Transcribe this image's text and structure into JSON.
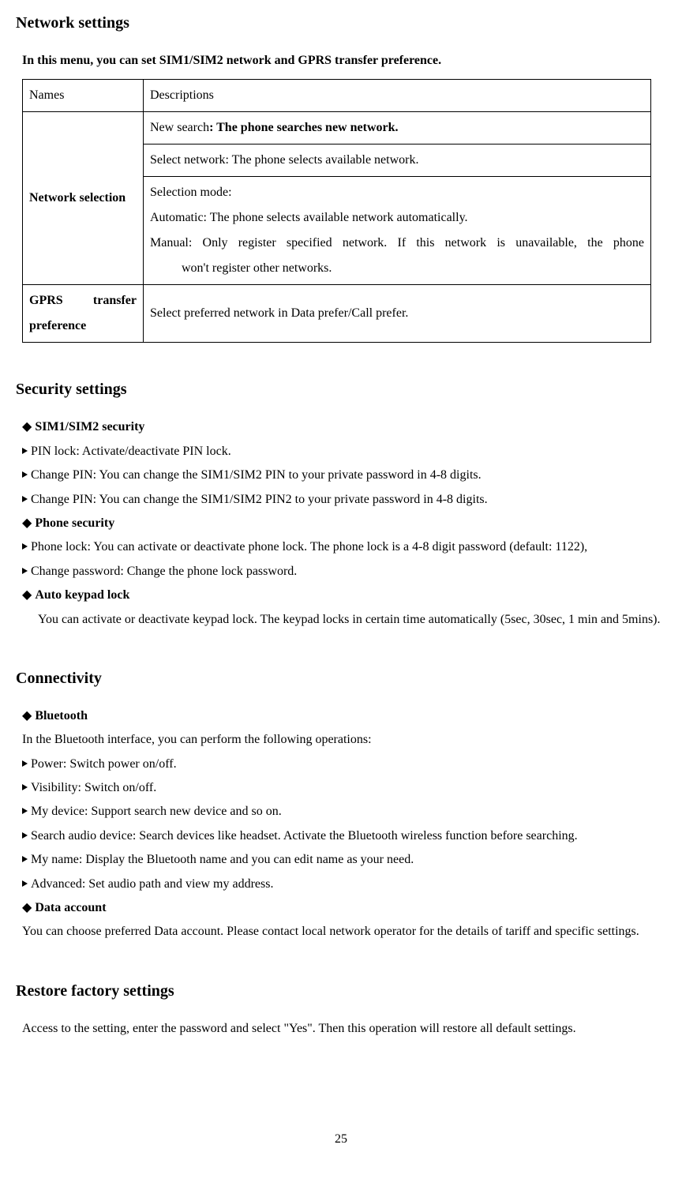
{
  "network": {
    "heading": "Network settings",
    "intro": "In this menu, you can set SIM1/SIM2 network and GPRS transfer preference.",
    "table": {
      "header_name": "Names",
      "header_desc": "Descriptions",
      "row1_name": "Network selection",
      "row1_desc_a_label": "New search",
      "row1_desc_a_rest": ": The phone searches new network.",
      "row1_desc_b": "Select network: The phone selects available network.",
      "row1_desc_c_line1": "Selection mode:",
      "row1_desc_c_line2": "Automatic: The phone selects available network automatically.",
      "row1_desc_c_line3": "Manual: Only register specified network. If this network is unavailable, the phone",
      "row1_desc_c_line4": "won't register other networks.",
      "row2_name": "GPRS transfer preference",
      "row2_desc": "Select preferred network in Data prefer/Call prefer."
    }
  },
  "security": {
    "heading": "Security settings",
    "sim_heading": "SIM1/SIM2 security",
    "sim_items": [
      "PIN lock: Activate/deactivate PIN lock.",
      "Change PIN: You can change the SIM1/SIM2 PIN to your private password in 4-8 digits.",
      "Change PIN: You can change the SIM1/SIM2 PIN2 to your private password in 4-8 digits."
    ],
    "phone_heading": "Phone security",
    "phone_items": [
      "Phone lock: You can activate or deactivate phone lock. The phone lock is a 4-8 digit password (default: 1122),",
      "Change password: Change the phone lock password."
    ],
    "auto_heading": "Auto keypad lock",
    "auto_para": "You can activate or deactivate keypad lock. The keypad locks in certain time automatically (5sec, 30sec, 1 min and 5mins)."
  },
  "connectivity": {
    "heading": "Connectivity",
    "bt_heading": "Bluetooth",
    "bt_intro": "In the Bluetooth interface, you can perform the following operations:",
    "bt_items": [
      "Power: Switch power on/off.",
      "Visibility: Switch on/off.",
      "My device: Support search new device and so on.",
      "Search audio device: Search devices like headset. Activate the Bluetooth wireless function before searching.",
      "My name: Display the Bluetooth name and you can edit name as your need.",
      "Advanced: Set audio path and view my address."
    ],
    "data_heading": "Data account",
    "data_para": "You can choose preferred Data account. Please contact local network operator for the details of tariff and specific settings."
  },
  "restore": {
    "heading": "Restore factory settings",
    "para": "Access to the setting, enter the password and select \"Yes\". Then this operation will restore all default settings."
  },
  "page_number": "25"
}
